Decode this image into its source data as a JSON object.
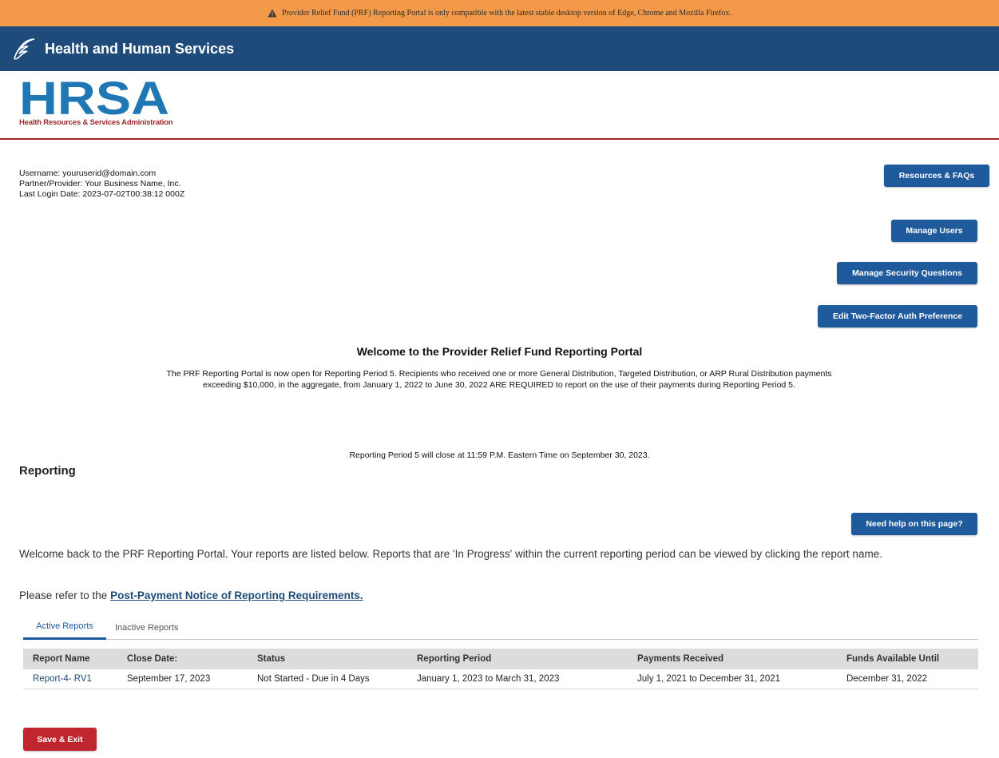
{
  "banner": {
    "icon": "warning-icon",
    "text": "Provider Relief Fund (PRF) Reporting Portal is only compatible with the latest stable desktop version of Edge, Chrome and Mozilla Firefox."
  },
  "header": {
    "icon": "hhs-eagle-icon",
    "title": "Health and Human Services"
  },
  "logo": {
    "main": "HRSA",
    "subtitle": "Health Resources & Services Administration"
  },
  "user": {
    "username": "Username: youruserid@domain.com",
    "partner": "Partner/Provider: Your Business Name, Inc.",
    "last_login": "Last Login Date: 2023-07-02T00:38:12 000Z"
  },
  "buttons": {
    "resources": "Resources & FAQs",
    "manage_users": "Manage Users",
    "security": "Manage Security Questions",
    "two_factor": "Edit Two-Factor Auth Preference",
    "help": "Need help on this page?",
    "save_exit": "Save & Exit"
  },
  "welcome": {
    "title": "Welcome to the Provider Relief Fund Reporting Portal",
    "text": "The PRF Reporting Portal  is now open for Reporting Period 5. Recipients who received one or more General Distribution, Targeted Distribution, or ARP Rural Distribution payments exceeding $10,000, in the aggregate, from January 1, 2022 to June 30, 2022 ARE REQUIRED to report on the use of their payments during Reporting Period 5.",
    "close": "Reporting Period 5 will close at 11:59 P.M. Eastern Time on September 30, 2023."
  },
  "reporting": {
    "heading": "Reporting",
    "intro": "Welcome back to the PRF Reporting Portal. Your reports are listed below. Reports that are 'In Progress' within the current reporting period can be viewed by clicking the report name.",
    "refer_prefix": "Please refer to the ",
    "refer_link": "Post-Payment Notice of Reporting Requirements."
  },
  "tabs": {
    "active": "Active Reports",
    "inactive": "Inactive Reports"
  },
  "table": {
    "headers": [
      "Report Name",
      "Close Date:",
      "Status",
      "Reporting Period",
      "Payments Received",
      "Funds Available Until"
    ],
    "rows": [
      [
        "Report-4- RV1",
        "September 17, 2023",
        "Not Started - Due in 4 Days",
        "January 1, 2023 to March 31, 2023",
        "July 1, 2021 to December 31, 2021",
        "December 31, 2022"
      ]
    ]
  },
  "colors": {
    "banner": "#f39a4a",
    "header": "#1e4b7a",
    "brand_red": "#9a2a2a",
    "button_blue": "#1e5a9c",
    "button_red": "#c0262d"
  }
}
